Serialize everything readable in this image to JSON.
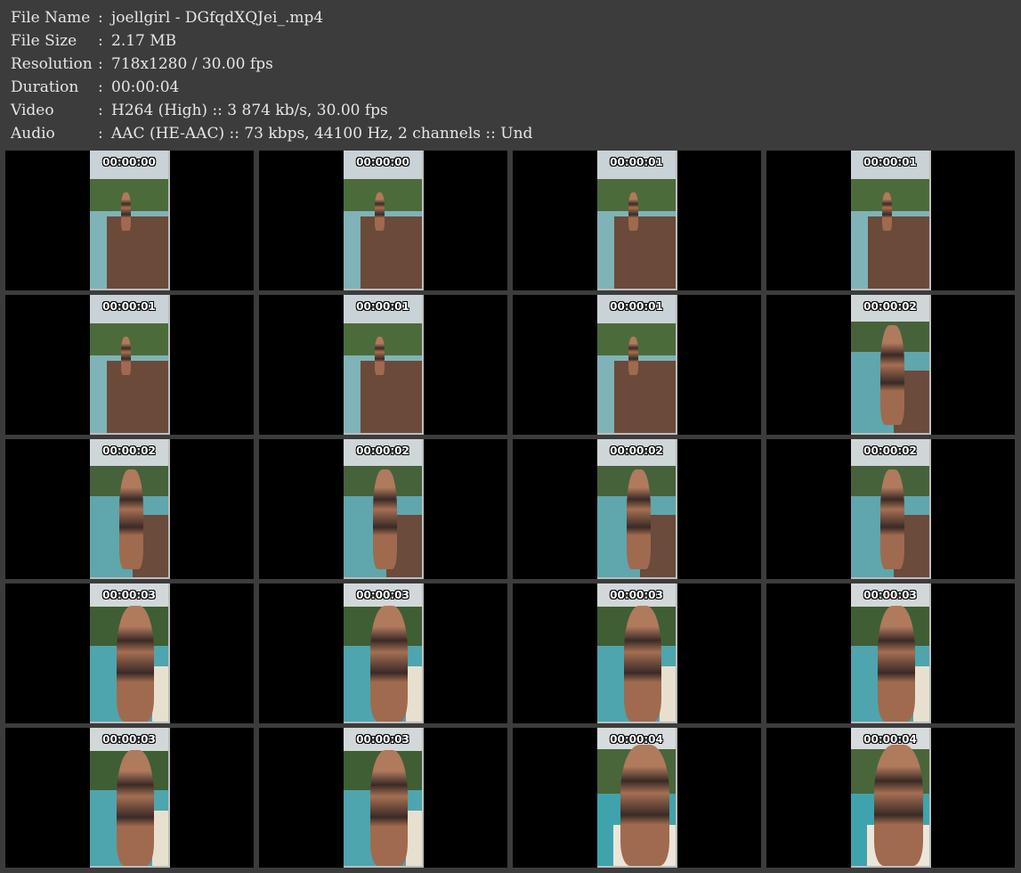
{
  "info": [
    {
      "label": "File Name",
      "sep": ":",
      "value": "joellgirl - DGfqdXQJei_.mp4"
    },
    {
      "label": "File Size",
      "sep": ":",
      "value": "2.17 MB"
    },
    {
      "label": "Resolution",
      "sep": ":",
      "value": "718x1280 / 30.00 fps"
    },
    {
      "label": "Duration",
      "sep": ":",
      "value": "00:00:04"
    },
    {
      "label": "Video",
      "sep": ":",
      "value": "H264 (High) :: 3 874 kb/s, 30.00 fps"
    },
    {
      "label": "Audio",
      "sep": ":",
      "value": "AAC (HE-AAC) :: 73 kbps, 44100 Hz, 2 channels :: Und"
    }
  ],
  "thumbnails": [
    {
      "time": "00:00:00",
      "scene": "far"
    },
    {
      "time": "00:00:00",
      "scene": "far"
    },
    {
      "time": "00:00:01",
      "scene": "far"
    },
    {
      "time": "00:00:01",
      "scene": "far"
    },
    {
      "time": "00:00:01",
      "scene": "far"
    },
    {
      "time": "00:00:01",
      "scene": "far"
    },
    {
      "time": "00:00:01",
      "scene": "far"
    },
    {
      "time": "00:00:02",
      "scene": "mid"
    },
    {
      "time": "00:00:02",
      "scene": "mid"
    },
    {
      "time": "00:00:02",
      "scene": "mid"
    },
    {
      "time": "00:00:02",
      "scene": "mid"
    },
    {
      "time": "00:00:02",
      "scene": "mid"
    },
    {
      "time": "00:00:03",
      "scene": "near"
    },
    {
      "time": "00:00:03",
      "scene": "near"
    },
    {
      "time": "00:00:03",
      "scene": "near"
    },
    {
      "time": "00:00:03",
      "scene": "near"
    },
    {
      "time": "00:00:03",
      "scene": "near"
    },
    {
      "time": "00:00:03",
      "scene": "near"
    },
    {
      "time": "00:00:04",
      "scene": "close"
    },
    {
      "time": "00:00:04",
      "scene": "close"
    }
  ],
  "colors": {
    "background": "#3c3c3c",
    "text": "#e6e6e6",
    "cell": "#000000"
  }
}
